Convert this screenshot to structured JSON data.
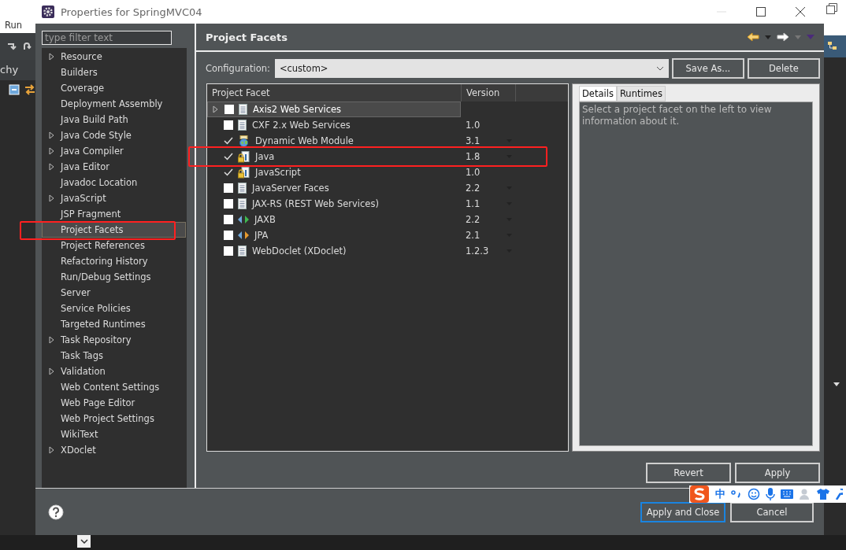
{
  "background_ide": {
    "menu_item": "Run",
    "view_tab": "chy"
  },
  "window": {
    "title": "Properties for SpringMVC04"
  },
  "filter": {
    "placeholder": "type filter text"
  },
  "sidebar": {
    "items": [
      {
        "label": "Resource",
        "expandable": true,
        "selected": false,
        "highlighted": false
      },
      {
        "label": "Builders",
        "expandable": false,
        "selected": false,
        "highlighted": false
      },
      {
        "label": "Coverage",
        "expandable": false,
        "selected": false,
        "highlighted": false
      },
      {
        "label": "Deployment Assembly",
        "expandable": false,
        "selected": false,
        "highlighted": false
      },
      {
        "label": "Java Build Path",
        "expandable": false,
        "selected": false,
        "highlighted": false
      },
      {
        "label": "Java Code Style",
        "expandable": true,
        "selected": false,
        "highlighted": false
      },
      {
        "label": "Java Compiler",
        "expandable": true,
        "selected": false,
        "highlighted": false
      },
      {
        "label": "Java Editor",
        "expandable": true,
        "selected": false,
        "highlighted": false
      },
      {
        "label": "Javadoc Location",
        "expandable": false,
        "selected": false,
        "highlighted": false
      },
      {
        "label": "JavaScript",
        "expandable": true,
        "selected": false,
        "highlighted": false
      },
      {
        "label": "JSP Fragment",
        "expandable": false,
        "selected": false,
        "highlighted": false
      },
      {
        "label": "Project Facets",
        "expandable": false,
        "selected": true,
        "highlighted": true
      },
      {
        "label": "Project References",
        "expandable": false,
        "selected": false,
        "highlighted": false
      },
      {
        "label": "Refactoring History",
        "expandable": false,
        "selected": false,
        "highlighted": false
      },
      {
        "label": "Run/Debug Settings",
        "expandable": false,
        "selected": false,
        "highlighted": false
      },
      {
        "label": "Server",
        "expandable": false,
        "selected": false,
        "highlighted": false
      },
      {
        "label": "Service Policies",
        "expandable": false,
        "selected": false,
        "highlighted": false
      },
      {
        "label": "Targeted Runtimes",
        "expandable": false,
        "selected": false,
        "highlighted": false
      },
      {
        "label": "Task Repository",
        "expandable": true,
        "selected": false,
        "highlighted": false
      },
      {
        "label": "Task Tags",
        "expandable": false,
        "selected": false,
        "highlighted": false
      },
      {
        "label": "Validation",
        "expandable": true,
        "selected": false,
        "highlighted": false
      },
      {
        "label": "Web Content Settings",
        "expandable": false,
        "selected": false,
        "highlighted": false
      },
      {
        "label": "Web Page Editor",
        "expandable": false,
        "selected": false,
        "highlighted": false
      },
      {
        "label": "Web Project Settings",
        "expandable": false,
        "selected": false,
        "highlighted": false
      },
      {
        "label": "WikiText",
        "expandable": false,
        "selected": false,
        "highlighted": false
      },
      {
        "label": "XDoclet",
        "expandable": true,
        "selected": false,
        "highlighted": false
      }
    ]
  },
  "page": {
    "title": "Project Facets"
  },
  "configuration": {
    "label": "Configuration:",
    "value": "<custom>",
    "buttons": [
      "Save As...",
      "Delete"
    ]
  },
  "facets": {
    "columns": [
      "Project Facet",
      "Version"
    ],
    "rows": [
      {
        "name": "Axis2 Web Services",
        "kind": "document",
        "expandable": true,
        "checked": false,
        "selected": true,
        "highlighted": false
      },
      {
        "name": "CXF 2.x Web Services",
        "kind": "document",
        "expandable": false,
        "checked": false,
        "selected": false,
        "highlighted": false,
        "version": "1.0",
        "dropdown": false
      },
      {
        "name": "Dynamic Web Module",
        "kind": "globe",
        "expandable": false,
        "checked": true,
        "selected": false,
        "highlighted": false,
        "version": "3.1",
        "dropdown": true
      },
      {
        "name": "Java",
        "kind": "locked",
        "expandable": false,
        "checked": true,
        "selected": false,
        "highlighted": true,
        "version": "1.8",
        "dropdown": true
      },
      {
        "name": "JavaScript",
        "kind": "locked",
        "expandable": false,
        "checked": true,
        "selected": false,
        "highlighted": false,
        "version": "1.0",
        "dropdown": false
      },
      {
        "name": "JavaServer Faces",
        "kind": "document",
        "expandable": false,
        "checked": false,
        "selected": false,
        "highlighted": false,
        "version": "2.2",
        "dropdown": true
      },
      {
        "name": "JAX-RS (REST Web Services)",
        "kind": "document",
        "expandable": false,
        "checked": false,
        "selected": false,
        "highlighted": false,
        "version": "1.1",
        "dropdown": true
      },
      {
        "name": "JAXB",
        "kind": "arrows",
        "color": "#3fb950",
        "expandable": false,
        "checked": false,
        "selected": false,
        "highlighted": false,
        "version": "2.2",
        "dropdown": true
      },
      {
        "name": "JPA",
        "kind": "arrows",
        "color": "#e69a2e",
        "expandable": false,
        "checked": false,
        "selected": false,
        "highlighted": false,
        "version": "2.1",
        "dropdown": true
      },
      {
        "name": "WebDoclet (XDoclet)",
        "kind": "document",
        "expandable": false,
        "checked": false,
        "selected": false,
        "highlighted": false,
        "version": "1.2.3",
        "dropdown": true
      }
    ]
  },
  "details": {
    "tabs": [
      {
        "label": "Details",
        "selected": true
      },
      {
        "label": "Runtimes",
        "selected": false
      }
    ],
    "text": "Select a project facet on the left to view information about it."
  },
  "page_buttons": [
    "Revert",
    "Apply"
  ],
  "footer_buttons": [
    {
      "label": "Apply and Close",
      "default": true
    },
    {
      "label": "Cancel",
      "default": false
    }
  ],
  "ime_bar": {
    "mode": "中"
  }
}
